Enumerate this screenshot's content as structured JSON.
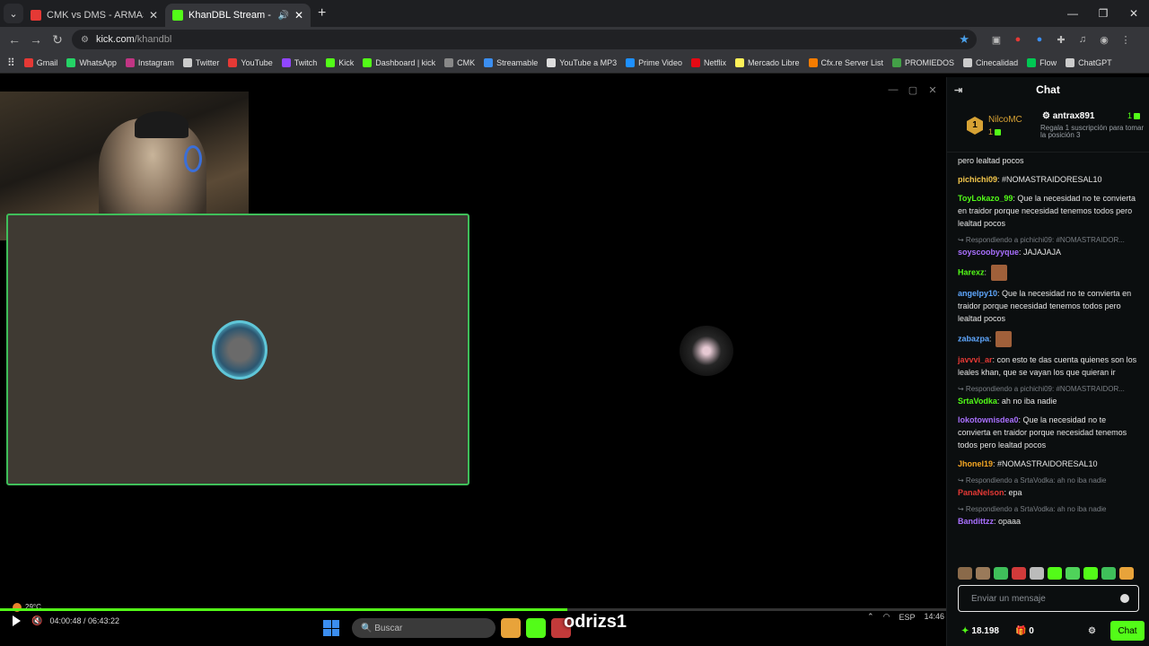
{
  "browser": {
    "tabs": [
      {
        "title": "CMK vs DMS - ARMAS LARGAS",
        "icon_color": "#e53935"
      },
      {
        "title": "KhanDBL Stream - Watch Li",
        "icon_color": "#53fc18"
      }
    ],
    "url_host": "kick.com",
    "url_path": "/khandbl",
    "bookmarks": [
      {
        "label": "Gmail",
        "color": "#e53935"
      },
      {
        "label": "WhatsApp",
        "color": "#25d366"
      },
      {
        "label": "Instagram",
        "color": "#c13584"
      },
      {
        "label": "Twitter",
        "color": "#cccccc"
      },
      {
        "label": "YouTube",
        "color": "#e53935"
      },
      {
        "label": "Twitch",
        "color": "#9146ff"
      },
      {
        "label": "Kick",
        "color": "#53fc18"
      },
      {
        "label": "Dashboard | kick",
        "color": "#53fc18"
      },
      {
        "label": "CMK",
        "color": "#888888"
      },
      {
        "label": "Streamable",
        "color": "#3b8ef0"
      },
      {
        "label": "YouTube a MP3",
        "color": "#dddddd"
      },
      {
        "label": "Prime Video",
        "color": "#1e90ff"
      },
      {
        "label": "Netflix",
        "color": "#e50914"
      },
      {
        "label": "Mercado Libre",
        "color": "#fff159"
      },
      {
        "label": "Cfx.re Server List",
        "color": "#f57c00"
      },
      {
        "label": "PROMIEDOS",
        "color": "#43a047"
      },
      {
        "label": "Cinecalidad",
        "color": "#cccccc"
      },
      {
        "label": "Flow",
        "color": "#00c853"
      },
      {
        "label": "ChatGPT",
        "color": "#cccccc"
      }
    ]
  },
  "player": {
    "weather": "29°C",
    "time": "04:00:48 / 06:43:22",
    "progress": 0.6,
    "overlay_name": "odrizs1"
  },
  "taskbar": {
    "search_placeholder": "Buscar",
    "lang": "ESP",
    "clock": "14:46"
  },
  "chat": {
    "title": "Chat",
    "leader1": {
      "rank": "1",
      "name": "NilcoMC",
      "count": "1"
    },
    "leader2": {
      "name": "antrax891",
      "count": "1",
      "note": "Regala 1 suscripción para tomar la posición 3"
    },
    "messages": [
      {
        "reply": "",
        "user": "",
        "color": "#ffffff",
        "text": "pero lealtad pocos"
      },
      {
        "reply": "",
        "user": "pichichi09",
        "color": "#f5c84c",
        "text": "#NOMASTRAIDORESAL10"
      },
      {
        "reply": "",
        "user": "ToyLokazo_99",
        "color": "#53fc18",
        "text": "Que la necesidad no te convierta en traidor porque necesidad tenemos todos pero lealtad pocos"
      },
      {
        "reply": "Respondiendo a pichichi09: #NOMASTRAIDOR...",
        "user": "soyscoobyyque",
        "color": "#a970ff",
        "text": "JAJAJAJA"
      },
      {
        "reply": "",
        "user": "Harexz",
        "color": "#53fc18",
        "text": ""
      },
      {
        "reply": "",
        "user": "angelpy10",
        "color": "#5fa8ff",
        "text": "Que la necesidad no te convierta en traidor porque necesidad tenemos todos pero lealtad pocos"
      },
      {
        "reply": "",
        "user": "zabazpa",
        "color": "#5fa8ff",
        "text": ""
      },
      {
        "reply": "",
        "user": "javvvi_ar",
        "color": "#e53935",
        "text": "con esto te das cuenta quienes son los leales khan, que se vayan los que quieran ir"
      },
      {
        "reply": "Respondiendo a pichichi09: #NOMASTRAIDOR...",
        "user": "SrtaVodka",
        "color": "#53fc18",
        "text": "ah no iba nadie"
      },
      {
        "reply": "",
        "user": "lokotownisdea0",
        "color": "#a970ff",
        "text": "Que la necesidad no te convierta en traidor porque necesidad tenemos todos pero lealtad pocos"
      },
      {
        "reply": "",
        "user": "Jhonel19",
        "color": "#f5a623",
        "text": "#NOMASTRAIDORESAL10"
      },
      {
        "reply": "Respondiendo a SrtaVodka: ah no iba nadie",
        "user": "PanaNelson",
        "color": "#e53935",
        "text": "epa"
      },
      {
        "reply": "Respondiendo a SrtaVodka: ah no iba nadie",
        "user": "Bandittzz",
        "color": "#a970ff",
        "text": "opaaa"
      }
    ],
    "input_placeholder": "Enviar un mensaje",
    "points": "18.198",
    "gifts": "0",
    "send_label": "Chat"
  }
}
